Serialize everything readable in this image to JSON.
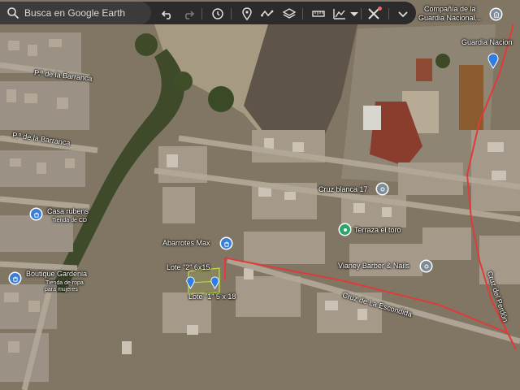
{
  "search": {
    "placeholder": "Busca en Google Earth"
  },
  "toolbar": {
    "icons": [
      "undo-icon",
      "redo-icon",
      "history-icon",
      "placemark-icon",
      "path-icon",
      "layers-icon",
      "measure-icon",
      "elevation-icon",
      "tools-icon",
      "dropdown-icon"
    ]
  },
  "places": {
    "guardia_top_line1": "Compañía de la",
    "guardia_top_line2": "Guardia Nacional...",
    "guardia_right": "Guardia Nacion",
    "barranca1": "P.º de la Barranca",
    "barranca2": "P.º de la Barranca",
    "casa_rubens": "Casa rubens",
    "casa_rubens_sub": "Tienda de CD",
    "boutique": "Boutique Gardenia",
    "boutique_sub1": "Tienda de ropa",
    "boutique_sub2": "para mujeres",
    "abarrotes": "Abarrotes Max",
    "lote2": "Lote \"2\" 6x15",
    "lote1": "Lote \"1\" 5 x 18",
    "cruz_blanca": "Cruz blanca 17",
    "terraza": "Terraza el toro",
    "vianey": "Vianey Barber & Nails",
    "escondida": "Cruz de La Escondida",
    "perdon": "Cruz del Perdón"
  },
  "colors": {
    "route": "#e03a3a",
    "poi_blue": "#3a7fd6",
    "poi_green": "#2fa36b",
    "poi_gray": "#7e8c99",
    "lot_outline": "#bfe04a",
    "marker_blue": "#2e7de0",
    "toolbar_bg": "#2b2b2b"
  }
}
